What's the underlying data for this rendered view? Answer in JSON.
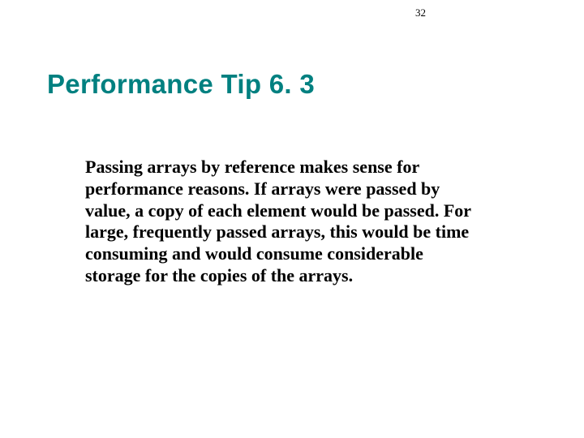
{
  "page": {
    "number": "32"
  },
  "slide": {
    "title": "Performance Tip 6. 3",
    "body": "Passing arrays by reference makes sense for performance reasons. If arrays were passed by value, a copy of each element would be passed. For large, frequently passed arrays, this would be time consuming and would consume considerable storage for the copies of the arrays."
  }
}
